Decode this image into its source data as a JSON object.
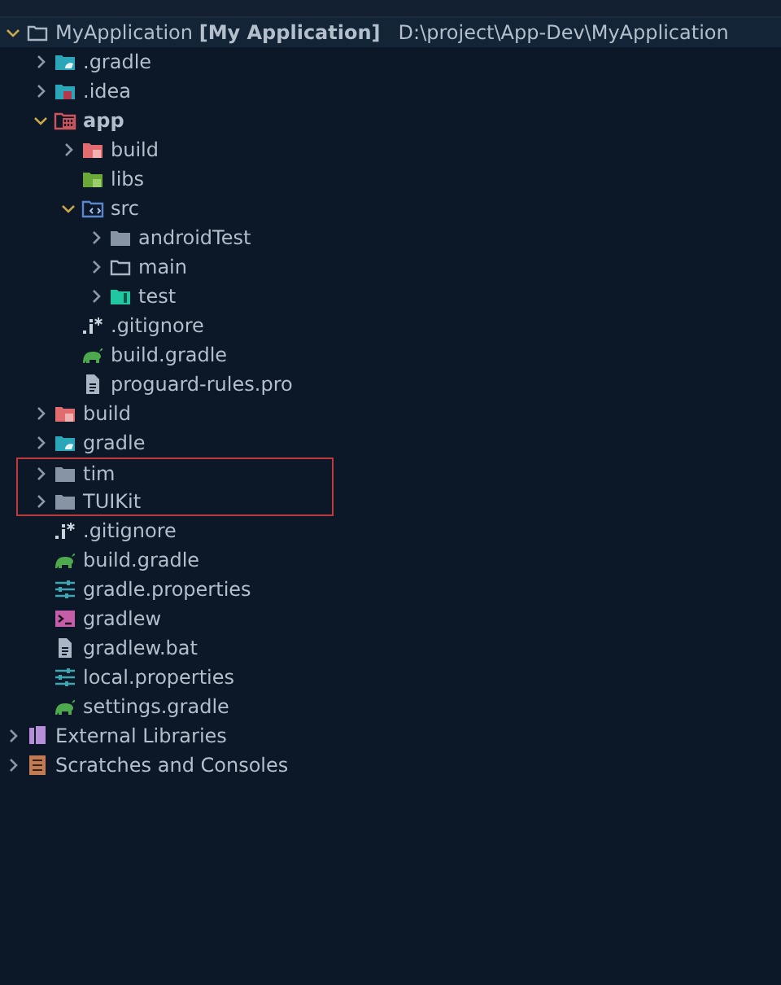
{
  "tree": [
    {
      "label": "MyApplication **[My Application]**",
      "path": "D:\\project\\App-Dev\\MyApplication",
      "kind": "folder-outline",
      "expanded": true,
      "selected": true,
      "children": [
        {
          "label": ".gradle",
          "kind": "folder-gradle",
          "expanded": false
        },
        {
          "label": ".idea",
          "kind": "folder-idea",
          "expanded": false
        },
        {
          "label": "app",
          "kind": "module",
          "bold": true,
          "expanded": true,
          "children": [
            {
              "label": "build",
              "kind": "folder-build",
              "expanded": false
            },
            {
              "label": "libs",
              "kind": "folder-libs"
            },
            {
              "label": "src",
              "kind": "folder-src",
              "expanded": true,
              "children": [
                {
                  "label": "androidTest",
                  "kind": "folder",
                  "expanded": false
                },
                {
                  "label": "main",
                  "kind": "folder-outline",
                  "expanded": false
                },
                {
                  "label": "test",
                  "kind": "folder-test",
                  "expanded": false
                }
              ]
            },
            {
              "label": ".gitignore",
              "kind": "ignore"
            },
            {
              "label": "build.gradle",
              "kind": "gradle"
            },
            {
              "label": "proguard-rules.pro",
              "kind": "file"
            }
          ]
        },
        {
          "label": "build",
          "kind": "folder-build",
          "expanded": false
        },
        {
          "label": "gradle",
          "kind": "folder-gradle",
          "expanded": false
        },
        {
          "label": "tim",
          "kind": "folder",
          "expanded": false,
          "highlighted": true
        },
        {
          "label": "TUIKit",
          "kind": "folder",
          "expanded": false,
          "highlighted": true
        },
        {
          "label": ".gitignore",
          "kind": "ignore"
        },
        {
          "label": "build.gradle",
          "kind": "gradle"
        },
        {
          "label": "gradle.properties",
          "kind": "properties"
        },
        {
          "label": "gradlew",
          "kind": "terminal"
        },
        {
          "label": "gradlew.bat",
          "kind": "file"
        },
        {
          "label": "local.properties",
          "kind": "properties"
        },
        {
          "label": "settings.gradle",
          "kind": "gradle"
        }
      ]
    },
    {
      "label": "External Libraries",
      "kind": "libraries",
      "expanded": false
    },
    {
      "label": "Scratches and Consoles",
      "kind": "scratches",
      "expanded": false
    }
  ]
}
